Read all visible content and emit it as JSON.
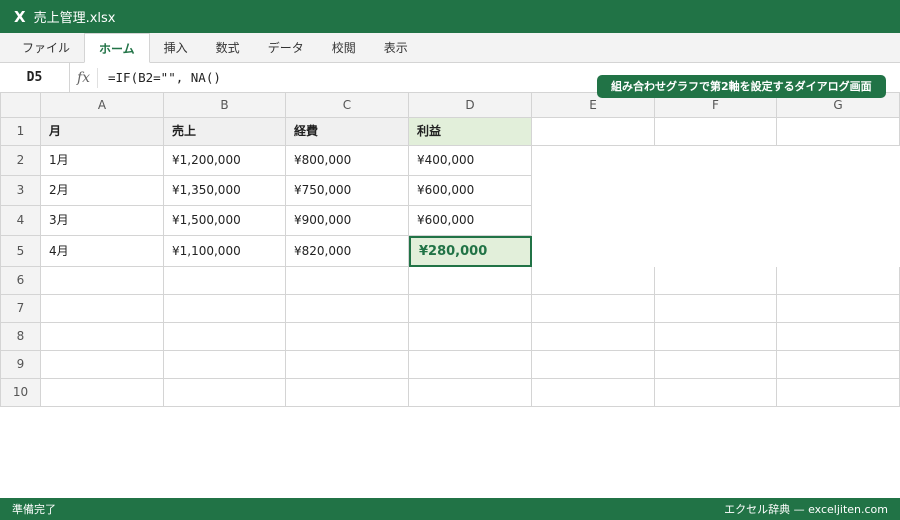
{
  "app": {
    "logo": "X",
    "title": "売上管理.xlsx"
  },
  "ribbon": {
    "tabs": [
      "ファイル",
      "ホーム",
      "挿入",
      "数式",
      "データ",
      "校閲",
      "表示"
    ],
    "active_index": 1
  },
  "formula_bar": {
    "cell_ref": "D5",
    "fx": "fx",
    "formula": "=IF(B2=\"\", NA()"
  },
  "callout": "組み合わせグラフで第2軸を設定するダイアログ画面",
  "sheet": {
    "columns": [
      "A",
      "B",
      "C",
      "D",
      "E",
      "F",
      "G"
    ],
    "rows": [
      "1",
      "2",
      "3",
      "4",
      "5",
      "6",
      "7",
      "8",
      "9",
      "10"
    ],
    "header": [
      "月",
      "売上",
      "経費",
      "利益"
    ],
    "data": [
      [
        "1月",
        "¥1,200,000",
        "¥800,000",
        "¥400,000"
      ],
      [
        "2月",
        "¥1,350,000",
        "¥750,000",
        "¥600,000"
      ],
      [
        "3月",
        "¥1,500,000",
        "¥900,000",
        "¥600,000"
      ],
      [
        "4月",
        "¥1,100,000",
        "¥820,000",
        "¥280,000"
      ]
    ],
    "selected_cell": "D5"
  },
  "status": {
    "left": "準備完了",
    "right": "エクセル辞典 — exceljiten.com"
  },
  "colors": {
    "brand": "#217346",
    "highlight": "#e2efda"
  }
}
